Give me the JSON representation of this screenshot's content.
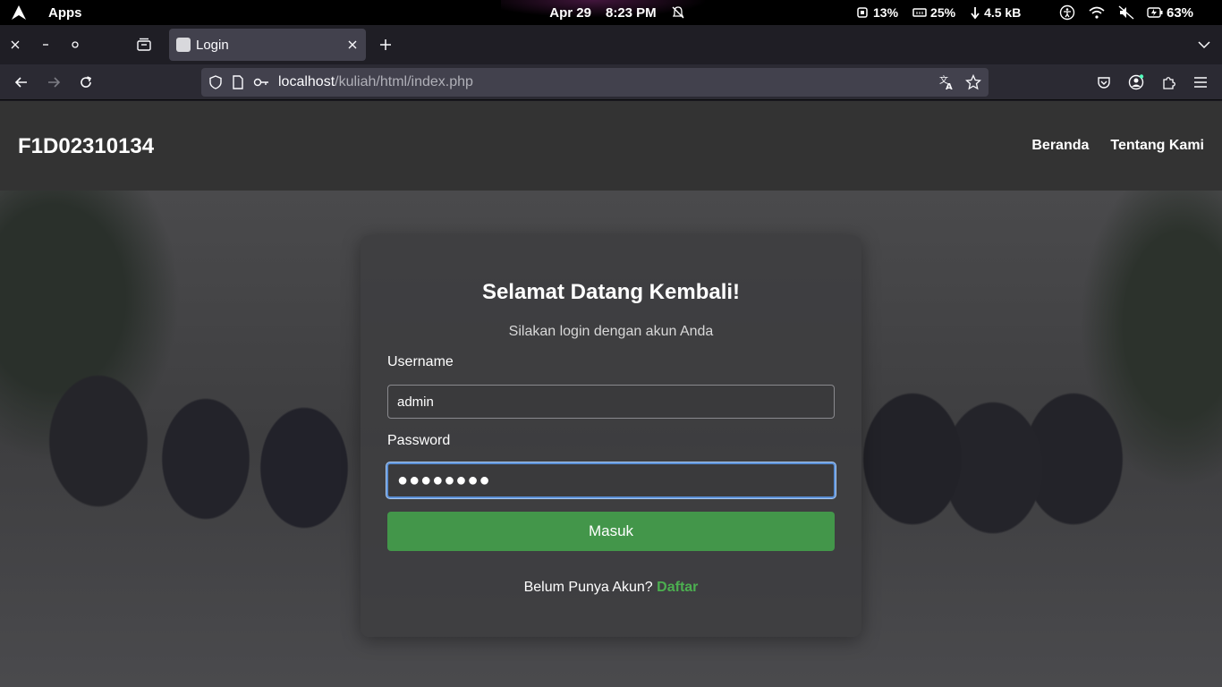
{
  "system_bar": {
    "apps_label": "Apps",
    "date": "Apr 29",
    "time": "8:23 PM",
    "cpu": "13%",
    "memory": "25%",
    "network": "4.5 kB",
    "battery": "63%"
  },
  "browser": {
    "tab_title": "Login",
    "url_host": "localhost",
    "url_path": "/kuliah/html/index.php"
  },
  "site": {
    "brand": "F1D02310134",
    "nav": [
      "Beranda",
      "Tentang Kami"
    ]
  },
  "login": {
    "title": "Selamat Datang Kembali!",
    "subtitle": "Silakan login dengan akun Anda",
    "username_label": "Username",
    "username_value": "admin",
    "password_label": "Password",
    "password_value": "●●●●●●●●",
    "submit_label": "Masuk",
    "register_prompt": "Belum Punya Akun?",
    "register_link": "Daftar"
  },
  "colors": {
    "submit": "#43964a",
    "link": "#4caf50",
    "focus": "#5b8fd6"
  }
}
